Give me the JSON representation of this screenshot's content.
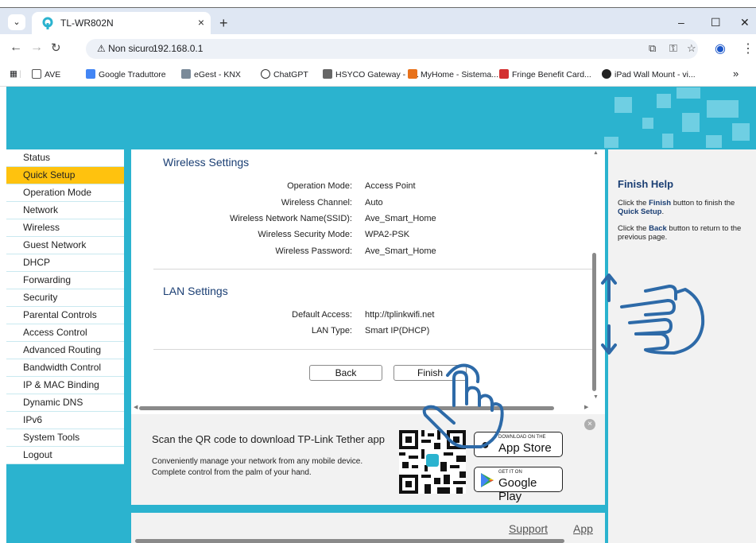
{
  "browser": {
    "tab_title": "TL-WR802N",
    "tab_close": "×",
    "new_tab": "+",
    "window_controls": [
      "–",
      "☐",
      "✕"
    ],
    "security_chip": "⚠ Non sicuro",
    "url": "192.168.0.1",
    "bookmarks": [
      {
        "label": "AVE",
        "color": "#555555",
        "icon": "folder-icon"
      },
      {
        "label": "Google Traduttore",
        "color": "#4285f4",
        "icon": "translate-icon"
      },
      {
        "label": "eGest - KNX",
        "color": "#7a8a99",
        "icon": "knx-icon"
      },
      {
        "label": "ChatGPT",
        "color": "#333333",
        "icon": "chatgpt-icon"
      },
      {
        "label": "HSYCO Gateway - s...",
        "color": "#666666",
        "icon": "hsyco-icon"
      },
      {
        "label": "MyHome - Sistema...",
        "color": "#e8711a",
        "icon": "myhome-icon"
      },
      {
        "label": "Fringe Benefit Card...",
        "color": "#d32f2f",
        "icon": "fringe-icon"
      },
      {
        "label": "iPad Wall Mount - vi...",
        "color": "#222222",
        "icon": "ipad-mount-icon"
      }
    ],
    "bookmarks_more": "»"
  },
  "sidebar": {
    "items": [
      {
        "label": "Status",
        "active": false
      },
      {
        "label": "Quick Setup",
        "active": true
      },
      {
        "label": "Operation Mode",
        "active": false
      },
      {
        "label": "Network",
        "active": false
      },
      {
        "label": "Wireless",
        "active": false
      },
      {
        "label": "Guest Network",
        "active": false
      },
      {
        "label": "DHCP",
        "active": false
      },
      {
        "label": "Forwarding",
        "active": false
      },
      {
        "label": "Security",
        "active": false
      },
      {
        "label": "Parental Controls",
        "active": false
      },
      {
        "label": "Access Control",
        "active": false
      },
      {
        "label": "Advanced Routing",
        "active": false
      },
      {
        "label": "Bandwidth Control",
        "active": false
      },
      {
        "label": "IP & MAC Binding",
        "active": false
      },
      {
        "label": "Dynamic DNS",
        "active": false
      },
      {
        "label": "IPv6",
        "active": false
      },
      {
        "label": "System Tools",
        "active": false
      },
      {
        "label": "Logout",
        "active": false
      }
    ]
  },
  "wireless": {
    "title": "Wireless Settings",
    "rows": [
      {
        "label": "Operation Mode:",
        "value": "Access Point"
      },
      {
        "label": "Wireless Channel:",
        "value": "Auto"
      },
      {
        "label": "Wireless Network Name(SSID):",
        "value": "Ave_Smart_Home"
      },
      {
        "label": "Wireless Security Mode:",
        "value": "WPA2-PSK"
      },
      {
        "label": "Wireless Password:",
        "value": "Ave_Smart_Home"
      }
    ]
  },
  "lan": {
    "title": "LAN Settings",
    "rows": [
      {
        "label": "Default Access:",
        "value": "http://tplinkwifi.net"
      },
      {
        "label": "LAN Type:",
        "value": "Smart IP(DHCP)"
      }
    ]
  },
  "buttons": {
    "back": "Back",
    "finish": "Finish"
  },
  "app_promo": {
    "title": "Scan the QR code to download TP-Link Tether app",
    "desc1": "Conveniently manage your network from any mobile device.",
    "desc2": "Complete control from the palm of your hand.",
    "appstore_small": "DOWNLOAD ON THE",
    "appstore_big": "App Store",
    "googleplay_small": "GET IT ON",
    "googleplay_big": "Google Play",
    "close": "×"
  },
  "footer": {
    "support": "Support",
    "app": "App"
  },
  "help": {
    "title": "Finish Help",
    "p1_a": "Click the ",
    "p1_b": "Finish",
    "p1_c": " button to finish the ",
    "p1_d": "Quick Setup",
    "p1_e": ".",
    "p2_a": "Click the ",
    "p2_b": "Back",
    "p2_c": " button to return to the previous page."
  },
  "colors": {
    "brand": "#2bb3cf",
    "active_menu": "#ffc20e",
    "heading": "#1a3e73",
    "gesture": "#2d6aa8"
  }
}
